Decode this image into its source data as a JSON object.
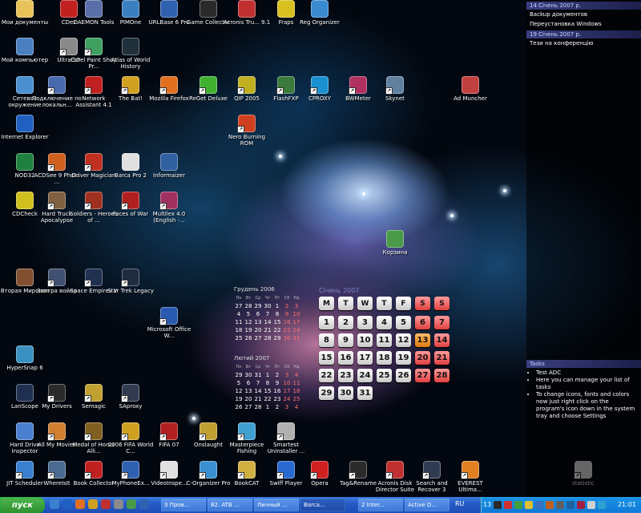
{
  "desktop_icons": [
    {
      "label": "Мои документы",
      "icon": "folder-icon",
      "color": "#e8c35a"
    },
    {
      "label": "CDex",
      "icon": "cd-icon",
      "color": "#c02020"
    },
    {
      "label": "DAEMON Tools",
      "icon": "daemon-icon",
      "color": "#5a6ea8"
    },
    {
      "label": "PIMOne",
      "icon": "pim-icon",
      "color": "#3a80c0"
    },
    {
      "label": "URLBase 6 Pro",
      "icon": "globe-icon",
      "color": "#3060b0"
    },
    {
      "label": "Game Collector",
      "icon": "gamepad-icon",
      "color": "#2a2a2a"
    },
    {
      "label": "Acronis Tru... 9.1",
      "icon": "acronis-icon",
      "color": "#c03030"
    },
    {
      "label": "Fraps",
      "icon": "fraps-icon",
      "color": "#d8c020"
    },
    {
      "label": "Reg Organizer",
      "icon": "registry-icon",
      "color": "#3a8ad0"
    },
    {
      "label": "Мой компьютер",
      "icon": "computer-icon",
      "color": "#4a80c0"
    },
    {
      "label": "UltraISO",
      "icon": "disc-icon",
      "color": "#8a8a8a"
    },
    {
      "label": "Corel Paint Shop Pr...",
      "icon": "paint-icon",
      "color": "#40a060"
    },
    {
      "label": "Atlas of World History",
      "icon": "atlas-icon",
      "color": "#20303a"
    },
    {
      "label": "Сетевое окружение",
      "icon": "network-icon",
      "color": "#4a90d0"
    },
    {
      "label": "Подключение по локальн...",
      "icon": "connection-icon",
      "color": "#4a6ab0"
    },
    {
      "label": "Network Assistant 4.1",
      "icon": "network-assistant-icon",
      "color": "#c02020"
    },
    {
      "label": "The Bat!",
      "icon": "bat-icon",
      "color": "#d0a020"
    },
    {
      "label": "Mozilla Firefox",
      "icon": "firefox-icon",
      "color": "#e07020"
    },
    {
      "label": "ReGet Deluxe",
      "icon": "reget-icon",
      "color": "#40b030"
    },
    {
      "label": "QIP 2005",
      "icon": "qip-icon",
      "color": "#c0b020"
    },
    {
      "label": "FlashFXP",
      "icon": "flashfxp-icon",
      "color": "#3a7a3a"
    },
    {
      "label": "CPROXY",
      "icon": "cproxy-icon",
      "color": "#1a90d0"
    },
    {
      "label": "BWMeter",
      "icon": "bwmeter-icon",
      "color": "#b03060"
    },
    {
      "label": "Skynet",
      "icon": "skynet-icon",
      "color": "#6080a0"
    },
    {
      "label": "Ad Muncher",
      "icon": "admuncher-icon",
      "color": "#c04040"
    },
    {
      "label": "Internet Explorer",
      "icon": "ie-icon",
      "color": "#2060c0"
    },
    {
      "label": "Nero Burning ROM",
      "icon": "nero-icon",
      "color": "#d04020"
    },
    {
      "label": "NOD32",
      "icon": "nod32-icon",
      "color": "#208040"
    },
    {
      "label": "ACDSee 9 Photo ...",
      "icon": "acdsee-icon",
      "color": "#d06020"
    },
    {
      "label": "Driver Magician",
      "icon": "driver-icon",
      "color": "#c03020"
    },
    {
      "label": "Barca Pro 2",
      "icon": "barca-icon",
      "color": "#e0e0e0"
    },
    {
      "label": "Informaizer",
      "icon": "informaizer-icon",
      "color": "#3060a0"
    },
    {
      "label": "CDCheck",
      "icon": "cdcheck-icon",
      "color": "#d0c020"
    },
    {
      "label": "Hard Truck Apocalypse",
      "icon": "truck-icon",
      "color": "#806040"
    },
    {
      "label": "Soldiers - Heroes of ...",
      "icon": "soldiers-icon",
      "color": "#a03020"
    },
    {
      "label": "Faces of War",
      "icon": "faces-of-war-icon",
      "color": "#b02020"
    },
    {
      "label": "Multilex 4.0 (English -...",
      "icon": "book-icon",
      "color": "#a03060"
    },
    {
      "label": "Корзина",
      "icon": "recycle-bin-icon",
      "color": "#4a9a4a"
    },
    {
      "label": "Вторая Мировая",
      "icon": "ww2-icon",
      "color": "#805030"
    },
    {
      "label": "Завтра война",
      "icon": "tomorrow-war-icon",
      "color": "#405070"
    },
    {
      "label": "Space Empires V",
      "icon": "space-empires-icon",
      "color": "#203050"
    },
    {
      "label": "Star Trek Legacy",
      "icon": "startrek-icon",
      "color": "#202a40"
    },
    {
      "label": "Microsoft Office W...",
      "icon": "word-icon",
      "color": "#2a5ab0"
    },
    {
      "label": "HyperSnap 6",
      "icon": "hypersnap-icon",
      "color": "#3a90c0"
    },
    {
      "label": "LanScope",
      "icon": "lanscope-icon",
      "color": "#203050"
    },
    {
      "label": "My Drivers",
      "icon": "drivers-icon",
      "color": "#2a2a2a"
    },
    {
      "label": "Semagic",
      "icon": "semagic-icon",
      "color": "#c0a030"
    },
    {
      "label": "SAproxy",
      "icon": "saproxy-icon",
      "color": "#303a50"
    },
    {
      "label": "Hard Drive Inspector",
      "icon": "hdd-icon",
      "color": "#4a80d0"
    },
    {
      "label": "All My Movies",
      "icon": "movies-icon",
      "color": "#d08030"
    },
    {
      "label": "Medal of Honor Alli...",
      "icon": "medal-icon",
      "color": "#806020"
    },
    {
      "label": "2006 FIFA World C...",
      "icon": "fifa-icon",
      "color": "#d0a020"
    },
    {
      "label": "FIFA 07",
      "icon": "fifa07-icon",
      "color": "#b02020"
    },
    {
      "label": "Onslaught",
      "icon": "onslaught-icon",
      "color": "#c0a030"
    },
    {
      "label": "Masterpiece Fishing",
      "icon": "fishing-icon",
      "color": "#40a0d0"
    },
    {
      "label": "Smartest Uninstaller ...",
      "icon": "uninstaller-icon",
      "color": "#b0b0b0"
    },
    {
      "label": "JIT Scheduler",
      "icon": "scheduler-icon",
      "color": "#3a80d0"
    },
    {
      "label": "WhereIsIt",
      "icon": "whereisit-icon",
      "color": "#4a6a90"
    },
    {
      "label": "Book Collector",
      "icon": "book-collector-icon",
      "color": "#c02020"
    },
    {
      "label": "MyPhoneEx...",
      "icon": "phone-icon",
      "color": "#3060b0"
    },
    {
      "label": "VideoInspe...",
      "icon": "video-inspector-icon",
      "color": "#e0e0e0"
    },
    {
      "label": "C-Organizer Pro",
      "icon": "c-organizer-icon",
      "color": "#3a90d0"
    },
    {
      "label": "BookCAT",
      "icon": "bookcat-icon",
      "color": "#d0b040"
    },
    {
      "label": "Swiff Player",
      "icon": "swiff-icon",
      "color": "#2a6ad0"
    },
    {
      "label": "Opera",
      "icon": "opera-icon",
      "color": "#d02020"
    },
    {
      "label": "Tag&Rename",
      "icon": "tagrename-icon",
      "color": "#2a2a2a"
    },
    {
      "label": "Acronis Disk Director Suite",
      "icon": "disk-director-icon",
      "color": "#c03030"
    },
    {
      "label": "Search and Recover 3",
      "icon": "search-recover-icon",
      "color": "#303a50"
    },
    {
      "label": "EVEREST Ultima...",
      "icon": "everest-icon",
      "color": "#e08020"
    },
    {
      "label": "statistic",
      "icon": "statistic-icon",
      "color": "#e0e0e0"
    }
  ],
  "sidebar": {
    "notes": [
      {
        "date": "14 Січень 2007 р.",
        "items": [
          "Backup документов",
          "Переустановка Windows"
        ]
      },
      {
        "date": "19 Січень 2007 р.",
        "items": [
          "Тези на конференцію"
        ]
      }
    ],
    "tasks": {
      "title": "Tasks",
      "items": [
        "Test ADC",
        "Here you can manage your list of tasks",
        "To change icons, fonts and colors now just right click on the program's icon down in the system tray and choose Settings"
      ]
    }
  },
  "mini_calendars": [
    {
      "title": "Грудень 2006",
      "headers": [
        "Пн",
        "Вт",
        "Ср",
        "Чт",
        "Пт",
        "Сб",
        "Нд"
      ],
      "rows": [
        [
          "27",
          "28",
          "29",
          "30",
          "1",
          "2",
          "3"
        ],
        [
          "4",
          "5",
          "6",
          "7",
          "8",
          "9",
          "10"
        ],
        [
          "11",
          "12",
          "13",
          "14",
          "15",
          "16",
          "17"
        ],
        [
          "18",
          "19",
          "20",
          "21",
          "22",
          "23",
          "24"
        ],
        [
          "25",
          "26",
          "27",
          "28",
          "29",
          "30",
          "31"
        ]
      ]
    },
    {
      "title": "Лютий 2007",
      "headers": [
        "Пн",
        "Вт",
        "Ср",
        "Чт",
        "Пт",
        "Сб",
        "Нд"
      ],
      "rows": [
        [
          "29",
          "30",
          "31",
          "1",
          "2",
          "3",
          "4"
        ],
        [
          "5",
          "6",
          "7",
          "8",
          "9",
          "10",
          "11"
        ],
        [
          "12",
          "13",
          "14",
          "15",
          "16",
          "17",
          "18"
        ],
        [
          "19",
          "20",
          "21",
          "22",
          "23",
          "24",
          "25"
        ],
        [
          "26",
          "27",
          "28",
          "1",
          "2",
          "3",
          "4"
        ]
      ]
    }
  ],
  "big_calendar": {
    "title": "Січень 2007",
    "headers": [
      "M",
      "T",
      "W",
      "T",
      "F",
      "S",
      "S"
    ],
    "rows": [
      [
        "1",
        "2",
        "3",
        "4",
        "5",
        "6",
        "7"
      ],
      [
        "8",
        "9",
        "10",
        "11",
        "12",
        "13",
        "14"
      ],
      [
        "15",
        "16",
        "17",
        "18",
        "19",
        "20",
        "21"
      ],
      [
        "22",
        "23",
        "24",
        "25",
        "26",
        "27",
        "28"
      ],
      [
        "29",
        "30",
        "31",
        "",
        "",
        "",
        ""
      ]
    ],
    "today": "13"
  },
  "taskbar": {
    "start_label": "пуск",
    "windows": [
      {
        "label": "3 Пров..."
      },
      {
        "label": "82. ATB ..."
      },
      {
        "label": "Личный ..."
      },
      {
        "label": "Barca..."
      },
      {
        "label": "2 Inter..."
      },
      {
        "label": "Active D..."
      }
    ],
    "language": "RU",
    "tray_count": "13",
    "clock": "21:01"
  }
}
